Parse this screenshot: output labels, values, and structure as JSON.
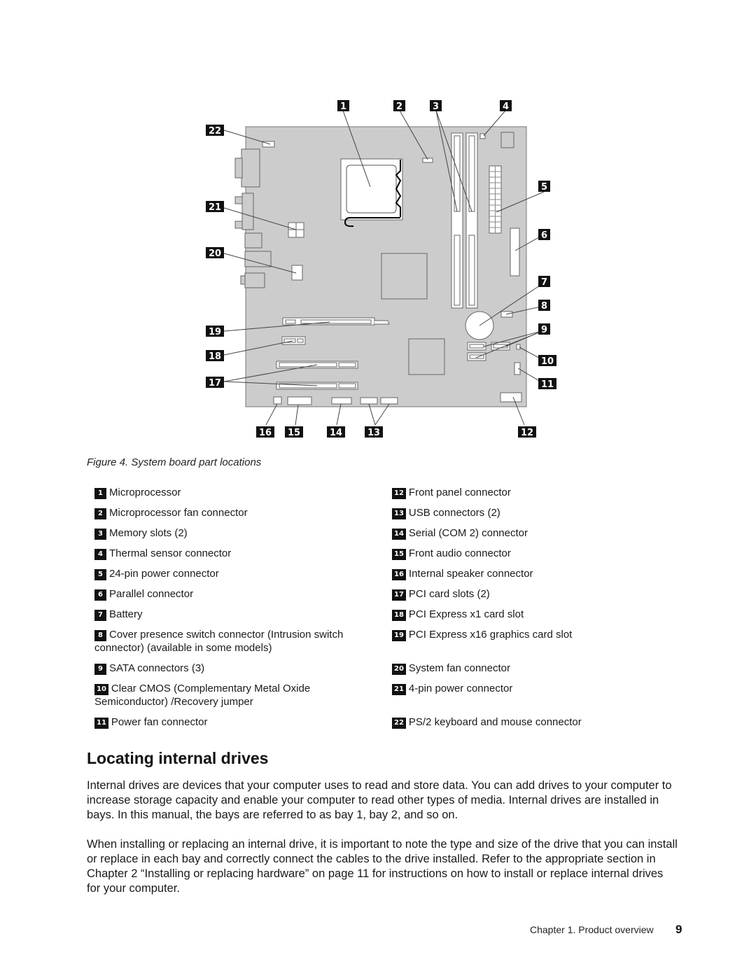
{
  "figure": {
    "caption": "Figure 4.  System board part locations",
    "callouts": [
      "1",
      "2",
      "3",
      "4",
      "5",
      "6",
      "7",
      "8",
      "9",
      "10",
      "11",
      "12",
      "13",
      "14",
      "15",
      "16",
      "17",
      "18",
      "19",
      "20",
      "21",
      "22"
    ]
  },
  "legend": {
    "left": [
      {
        "num": "1",
        "text": "Microprocessor"
      },
      {
        "num": "2",
        "text": "Microprocessor fan connector"
      },
      {
        "num": "3",
        "text": "Memory slots (2)"
      },
      {
        "num": "4",
        "text": "Thermal sensor connector"
      },
      {
        "num": "5",
        "text": "24-pin power connector"
      },
      {
        "num": "6",
        "text": "Parallel connector"
      },
      {
        "num": "7",
        "text": "Battery"
      },
      {
        "num": "8",
        "text": "Cover presence switch connector (Intrusion switch connector) (available in some models)"
      },
      {
        "num": "9",
        "text": "SATA connectors (3)"
      },
      {
        "num": "10",
        "text": "Clear CMOS (Complementary Metal Oxide Semiconductor) /Recovery jumper"
      },
      {
        "num": "11",
        "text": "Power fan connector"
      }
    ],
    "right": [
      {
        "num": "12",
        "text": "Front panel connector"
      },
      {
        "num": "13",
        "text": "USB connectors (2)"
      },
      {
        "num": "14",
        "text": "Serial (COM 2) connector"
      },
      {
        "num": "15",
        "text": "Front audio connector"
      },
      {
        "num": "16",
        "text": "Internal speaker connector"
      },
      {
        "num": "17",
        "text": "PCI card slots (2)"
      },
      {
        "num": "18",
        "text": "PCI Express x1 card slot"
      },
      {
        "num": "19",
        "text": "PCI Express x16 graphics card slot"
      },
      {
        "num": "20",
        "text": "System fan connector"
      },
      {
        "num": "21",
        "text": "4-pin power connector"
      },
      {
        "num": "22",
        "text": "PS/2 keyboard and mouse connector"
      }
    ]
  },
  "section": {
    "heading": "Locating internal drives",
    "paragraphs": [
      "Internal drives are devices that your computer uses to read and store data.  You can add drives to your computer to increase storage capacity and enable your computer to read other types of media.  Internal drives are installed in bays.  In this manual, the bays are referred to as bay 1, bay 2, and so on.",
      "When installing or replacing an internal drive, it is important to note the type and size of the drive that you can install or replace in each bay and correctly connect the cables to the drive installed.  Refer to the appropriate section in Chapter 2 “Installing or replacing hardware” on page 11 for instructions on how to install or replace internal drives for your computer."
    ]
  },
  "footer": {
    "chapter": "Chapter 1.  Product overview",
    "page": "9"
  }
}
